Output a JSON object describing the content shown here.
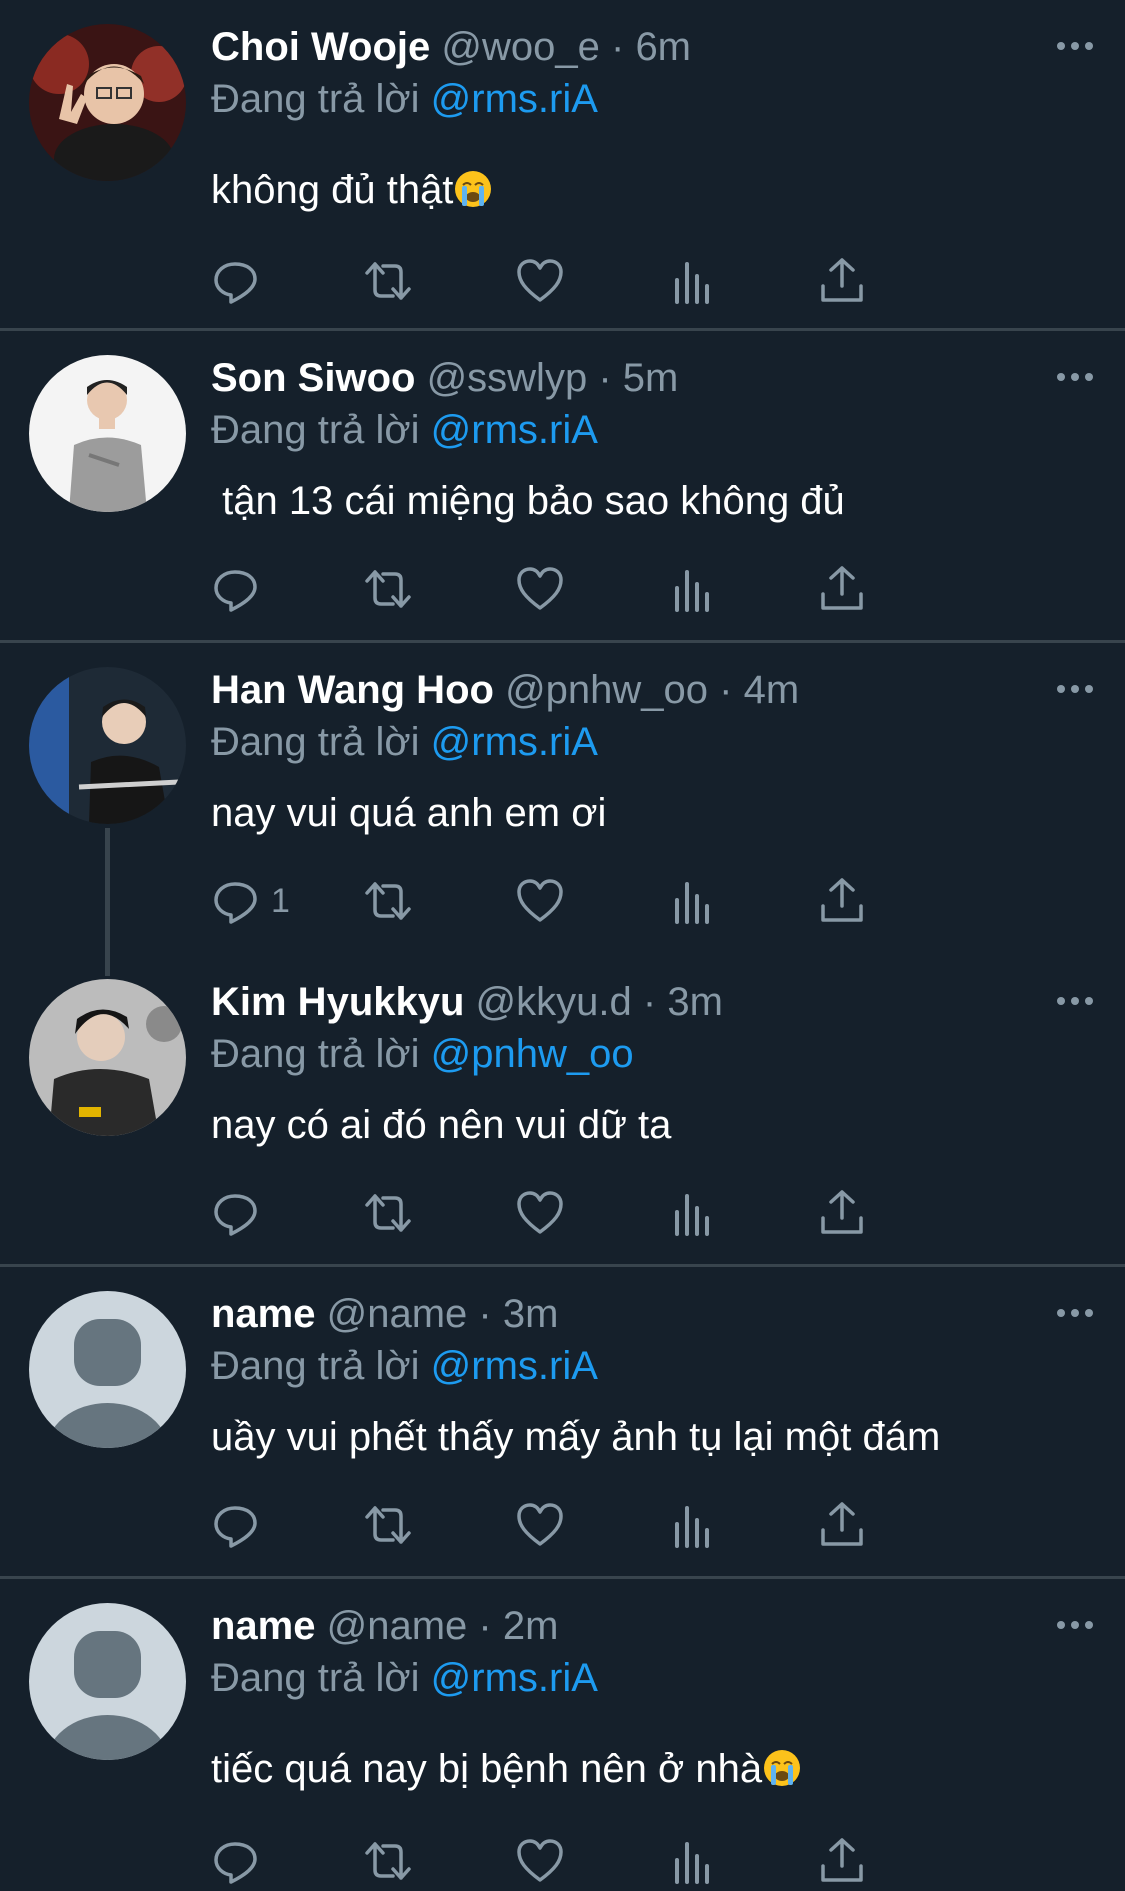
{
  "tweets": [
    {
      "name": "Choi Wooje",
      "handle": "@woo_e",
      "sep": "·",
      "time": "6m",
      "reply_prefix": "Đang trả lời",
      "reply_to": "@rms.riA",
      "text": "không đủ thật",
      "emoji": "crying-face",
      "reply_count": ""
    },
    {
      "name": "Son Siwoo",
      "handle": "@sswlyp",
      "sep": "·",
      "time": "5m",
      "reply_prefix": "Đang trả lời",
      "reply_to": "@rms.riA",
      "text": " tận 13 cái miệng bảo sao không đủ",
      "emoji": "",
      "reply_count": ""
    },
    {
      "name": "Han Wang Hoo",
      "handle": "@pnhw_oo",
      "sep": "·",
      "time": "4m",
      "reply_prefix": "Đang trả lời",
      "reply_to": "@rms.riA",
      "text": "nay vui quá anh em ơi",
      "emoji": "",
      "reply_count": "1"
    },
    {
      "name": "Kim Hyukkyu",
      "handle": "@kkyu.d",
      "sep": "·",
      "time": "3m",
      "reply_prefix": "Đang trả lời",
      "reply_to": "@pnhw_oo",
      "text": "nay có ai đó nên vui dữ ta",
      "emoji": "",
      "reply_count": ""
    },
    {
      "name": "name",
      "handle": "@name",
      "sep": "·",
      "time": "3m",
      "reply_prefix": "Đang trả lời",
      "reply_to": "@rms.riA",
      "text": "uầy vui phết thấy mấy ảnh tụ lại một đám",
      "emoji": "",
      "reply_count": ""
    },
    {
      "name": "name",
      "handle": "@name",
      "sep": "·",
      "time": "2m",
      "reply_prefix": "Đang trả lời",
      "reply_to": "@rms.riA",
      "text": "tiếc quá nay bị bệnh nên ở nhà",
      "emoji": "crying-face",
      "reply_count": ""
    }
  ],
  "icons": {
    "reply": "reply-icon",
    "retweet": "retweet-icon",
    "like": "like-icon",
    "views": "views-icon",
    "share": "share-icon",
    "more": "more-icon"
  },
  "colors": {
    "background": "#15202b",
    "divider": "#38444d",
    "muted": "#8899a6",
    "link": "#1d9bf0"
  }
}
